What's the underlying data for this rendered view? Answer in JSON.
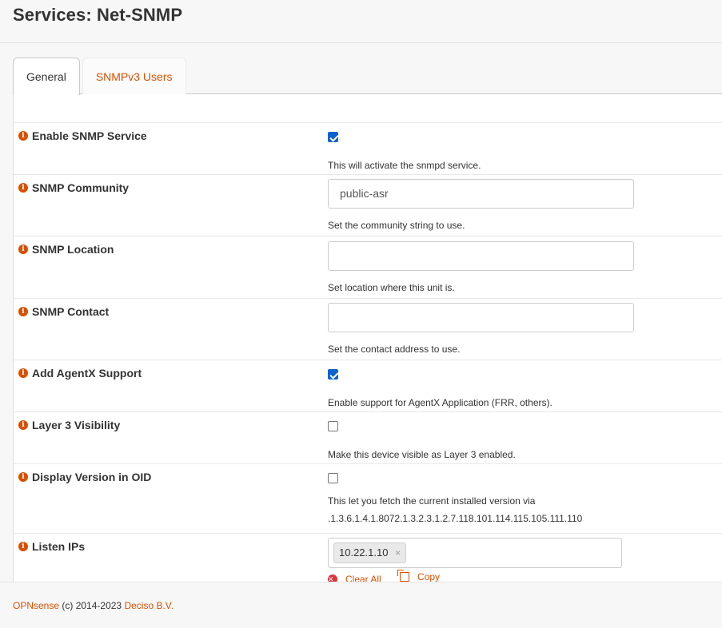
{
  "header": {
    "title": "Services: Net-SNMP"
  },
  "tabs": [
    {
      "label": "General",
      "active": true
    },
    {
      "label": "SNMPv3 Users",
      "active": false
    }
  ],
  "form": {
    "enable": {
      "label": "Enable SNMP Service",
      "checked": true,
      "help": "This will activate the snmpd service."
    },
    "community": {
      "label": "SNMP Community",
      "value": "public-asr",
      "help": "Set the community string to use."
    },
    "location": {
      "label": "SNMP Location",
      "value": "",
      "help": "Set location where this unit is."
    },
    "contact": {
      "label": "SNMP Contact",
      "value": "",
      "help": "Set the contact address to use."
    },
    "agentx": {
      "label": "Add AgentX Support",
      "checked": true,
      "help": "Enable support for AgentX Application (FRR, others)."
    },
    "layer3": {
      "label": "Layer 3 Visibility",
      "checked": false,
      "help": "Make this device visible as Layer 3 enabled."
    },
    "version_oid": {
      "label": "Display Version in OID",
      "checked": false,
      "help_line1": "This let you fetch the current installed version via",
      "help_line2": ".1.3.6.1.4.1.8072.1.3.2.3.1.2.7.118.101.114.115.105.111.110"
    },
    "listen_ips": {
      "label": "Listen IPs",
      "tags": [
        "10.22.1.10"
      ],
      "tag_remove": "×",
      "clear_all": "Clear All",
      "copy": "Copy"
    }
  },
  "footer": {
    "brand": "OPNsense",
    "copyright": "(c) 2014-2023",
    "company": "Deciso B.V."
  },
  "colors": {
    "accent": "#d94f00",
    "checkbox": "#0b63ce"
  }
}
